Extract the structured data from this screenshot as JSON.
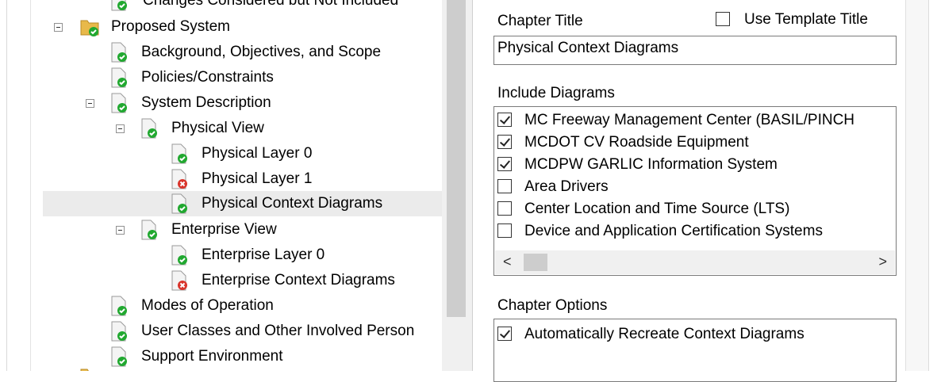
{
  "tree": {
    "items": [
      {
        "label": "Changes Considered but Not Included",
        "status": "ok"
      },
      {
        "label": "Proposed System",
        "status": "ok",
        "expanded": true
      },
      {
        "label": "Background, Objectives, and Scope",
        "status": "ok"
      },
      {
        "label": "Policies/Constraints",
        "status": "ok"
      },
      {
        "label": "System Description",
        "status": "ok",
        "expanded": true
      },
      {
        "label": "Physical View",
        "status": "ok",
        "expanded": true
      },
      {
        "label": "Physical Layer 0",
        "status": "ok"
      },
      {
        "label": "Physical Layer 1",
        "status": "error"
      },
      {
        "label": "Physical Context Diagrams",
        "status": "ok",
        "selected": true
      },
      {
        "label": "Enterprise View",
        "status": "ok",
        "expanded": true
      },
      {
        "label": "Enterprise Layer 0",
        "status": "ok"
      },
      {
        "label": "Enterprise Context Diagrams",
        "status": "error"
      },
      {
        "label": "Modes of Operation",
        "status": "ok"
      },
      {
        "label": "User Classes and Other Involved Person",
        "status": "ok"
      },
      {
        "label": "Support Environment",
        "status": "ok"
      }
    ]
  },
  "panel": {
    "chapter_title_label": "Chapter Title",
    "use_template_title_label": "Use Template Title",
    "use_template_title_checked": false,
    "chapter_title_value": "Physical Context Diagrams",
    "include_diagrams_label": "Include Diagrams",
    "diagrams": [
      {
        "label": "MC Freeway Management Center (BASIL/PINCH",
        "checked": true
      },
      {
        "label": "MCDOT CV Roadside Equipment",
        "checked": true
      },
      {
        "label": "MCDPW GARLIC Information System",
        "checked": true
      },
      {
        "label": "Area Drivers",
        "checked": false
      },
      {
        "label": "Center Location and Time Source (LTS)",
        "checked": false
      },
      {
        "label": "Device and Application Certification Systems",
        "checked": false
      }
    ],
    "scroll_left": "<",
    "scroll_right": ">",
    "chapter_options_label": "Chapter Options",
    "options": [
      {
        "label": "Automatically Recreate Context Diagrams",
        "checked": true
      }
    ]
  },
  "colors": {
    "ok_badge": "#21a830",
    "error_badge": "#d9342b",
    "folder": "#e8b94a",
    "selection": "#ebebeb"
  }
}
